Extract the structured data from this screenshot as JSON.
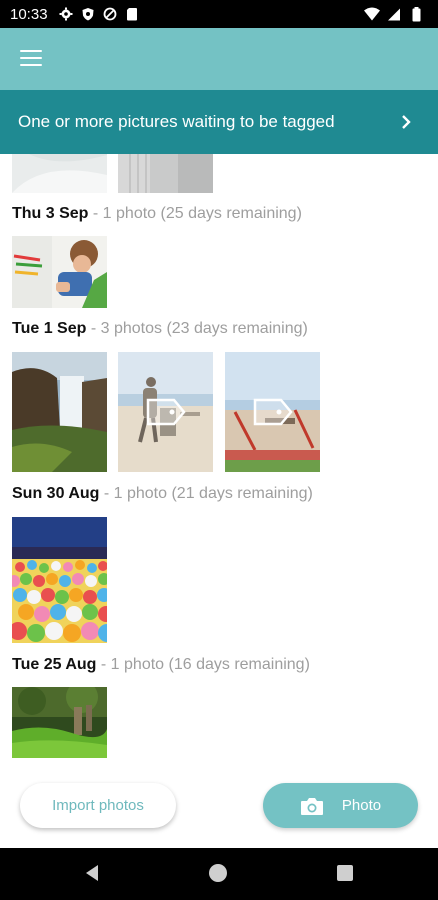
{
  "status_bar": {
    "time": "10:33"
  },
  "app_bar": {
    "menu_icon": "menu-icon"
  },
  "banner": {
    "text": "One or more pictures waiting to be tagged"
  },
  "days": [
    {
      "date": "Thu 3 Sep",
      "summary": " - 1 photo (25 days remaining)"
    },
    {
      "date": "Tue 1 Sep",
      "summary": " - 3 photos (23 days remaining)"
    },
    {
      "date": "Sun 30 Aug",
      "summary": " - 1 photo (21 days remaining)"
    },
    {
      "date": "Tue 25 Aug",
      "summary": " - 1 photo (16 days remaining)"
    }
  ],
  "buttons": {
    "import_label": "Import photos",
    "photo_label": "Photo"
  }
}
